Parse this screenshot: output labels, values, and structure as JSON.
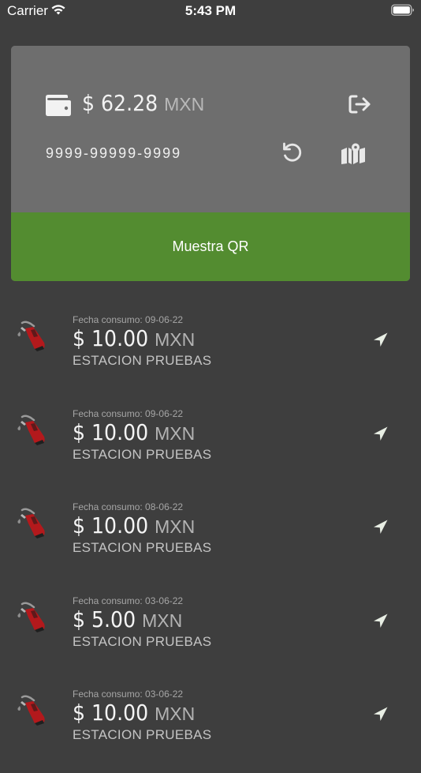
{
  "status_bar": {
    "carrier": "Carrier",
    "time": "5:43 PM"
  },
  "wallet_card": {
    "balance_amount": "$ 62.28",
    "balance_currency": "MXN",
    "card_number": "9999-99999-9999",
    "qr_button_label": "Muestra QR",
    "icons": {
      "wallet": "wallet-icon",
      "logout": "logout-icon",
      "refresh": "refresh-icon",
      "map": "map-icon"
    }
  },
  "transactions": [
    {
      "date": "Fecha consumo: 09-06-22",
      "amount": "$ 10.00",
      "currency": "MXN",
      "station": "ESTACION PRUEBAS"
    },
    {
      "date": "Fecha consumo: 09-06-22",
      "amount": "$ 10.00",
      "currency": "MXN",
      "station": "ESTACION PRUEBAS"
    },
    {
      "date": "Fecha consumo: 08-06-22",
      "amount": "$ 10.00",
      "currency": "MXN",
      "station": "ESTACION PRUEBAS"
    },
    {
      "date": "Fecha consumo: 03-06-22",
      "amount": "$ 5.00",
      "currency": "MXN",
      "station": "ESTACION PRUEBAS"
    },
    {
      "date": "Fecha consumo: 03-06-22",
      "amount": "$ 10.00",
      "currency": "MXN",
      "station": "ESTACION PRUEBAS"
    }
  ],
  "colors": {
    "background": "#3e3e3e",
    "card": "#6e6e6e",
    "accent_green": "#538c30",
    "pump_red": "#b3191c",
    "nav_icon": "#e8eee4"
  }
}
